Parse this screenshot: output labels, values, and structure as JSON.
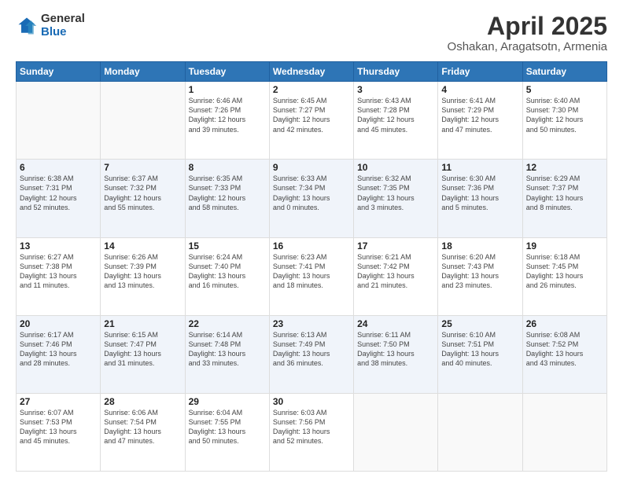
{
  "header": {
    "logo_general": "General",
    "logo_blue": "Blue",
    "title": "April 2025",
    "subtitle": "Oshakan, Aragatsotn, Armenia"
  },
  "weekdays": [
    "Sunday",
    "Monday",
    "Tuesday",
    "Wednesday",
    "Thursday",
    "Friday",
    "Saturday"
  ],
  "weeks": [
    [
      {
        "day": "",
        "info": ""
      },
      {
        "day": "",
        "info": ""
      },
      {
        "day": "1",
        "info": "Sunrise: 6:46 AM\nSunset: 7:26 PM\nDaylight: 12 hours\nand 39 minutes."
      },
      {
        "day": "2",
        "info": "Sunrise: 6:45 AM\nSunset: 7:27 PM\nDaylight: 12 hours\nand 42 minutes."
      },
      {
        "day": "3",
        "info": "Sunrise: 6:43 AM\nSunset: 7:28 PM\nDaylight: 12 hours\nand 45 minutes."
      },
      {
        "day": "4",
        "info": "Sunrise: 6:41 AM\nSunset: 7:29 PM\nDaylight: 12 hours\nand 47 minutes."
      },
      {
        "day": "5",
        "info": "Sunrise: 6:40 AM\nSunset: 7:30 PM\nDaylight: 12 hours\nand 50 minutes."
      }
    ],
    [
      {
        "day": "6",
        "info": "Sunrise: 6:38 AM\nSunset: 7:31 PM\nDaylight: 12 hours\nand 52 minutes."
      },
      {
        "day": "7",
        "info": "Sunrise: 6:37 AM\nSunset: 7:32 PM\nDaylight: 12 hours\nand 55 minutes."
      },
      {
        "day": "8",
        "info": "Sunrise: 6:35 AM\nSunset: 7:33 PM\nDaylight: 12 hours\nand 58 minutes."
      },
      {
        "day": "9",
        "info": "Sunrise: 6:33 AM\nSunset: 7:34 PM\nDaylight: 13 hours\nand 0 minutes."
      },
      {
        "day": "10",
        "info": "Sunrise: 6:32 AM\nSunset: 7:35 PM\nDaylight: 13 hours\nand 3 minutes."
      },
      {
        "day": "11",
        "info": "Sunrise: 6:30 AM\nSunset: 7:36 PM\nDaylight: 13 hours\nand 5 minutes."
      },
      {
        "day": "12",
        "info": "Sunrise: 6:29 AM\nSunset: 7:37 PM\nDaylight: 13 hours\nand 8 minutes."
      }
    ],
    [
      {
        "day": "13",
        "info": "Sunrise: 6:27 AM\nSunset: 7:38 PM\nDaylight: 13 hours\nand 11 minutes."
      },
      {
        "day": "14",
        "info": "Sunrise: 6:26 AM\nSunset: 7:39 PM\nDaylight: 13 hours\nand 13 minutes."
      },
      {
        "day": "15",
        "info": "Sunrise: 6:24 AM\nSunset: 7:40 PM\nDaylight: 13 hours\nand 16 minutes."
      },
      {
        "day": "16",
        "info": "Sunrise: 6:23 AM\nSunset: 7:41 PM\nDaylight: 13 hours\nand 18 minutes."
      },
      {
        "day": "17",
        "info": "Sunrise: 6:21 AM\nSunset: 7:42 PM\nDaylight: 13 hours\nand 21 minutes."
      },
      {
        "day": "18",
        "info": "Sunrise: 6:20 AM\nSunset: 7:43 PM\nDaylight: 13 hours\nand 23 minutes."
      },
      {
        "day": "19",
        "info": "Sunrise: 6:18 AM\nSunset: 7:45 PM\nDaylight: 13 hours\nand 26 minutes."
      }
    ],
    [
      {
        "day": "20",
        "info": "Sunrise: 6:17 AM\nSunset: 7:46 PM\nDaylight: 13 hours\nand 28 minutes."
      },
      {
        "day": "21",
        "info": "Sunrise: 6:15 AM\nSunset: 7:47 PM\nDaylight: 13 hours\nand 31 minutes."
      },
      {
        "day": "22",
        "info": "Sunrise: 6:14 AM\nSunset: 7:48 PM\nDaylight: 13 hours\nand 33 minutes."
      },
      {
        "day": "23",
        "info": "Sunrise: 6:13 AM\nSunset: 7:49 PM\nDaylight: 13 hours\nand 36 minutes."
      },
      {
        "day": "24",
        "info": "Sunrise: 6:11 AM\nSunset: 7:50 PM\nDaylight: 13 hours\nand 38 minutes."
      },
      {
        "day": "25",
        "info": "Sunrise: 6:10 AM\nSunset: 7:51 PM\nDaylight: 13 hours\nand 40 minutes."
      },
      {
        "day": "26",
        "info": "Sunrise: 6:08 AM\nSunset: 7:52 PM\nDaylight: 13 hours\nand 43 minutes."
      }
    ],
    [
      {
        "day": "27",
        "info": "Sunrise: 6:07 AM\nSunset: 7:53 PM\nDaylight: 13 hours\nand 45 minutes."
      },
      {
        "day": "28",
        "info": "Sunrise: 6:06 AM\nSunset: 7:54 PM\nDaylight: 13 hours\nand 47 minutes."
      },
      {
        "day": "29",
        "info": "Sunrise: 6:04 AM\nSunset: 7:55 PM\nDaylight: 13 hours\nand 50 minutes."
      },
      {
        "day": "30",
        "info": "Sunrise: 6:03 AM\nSunset: 7:56 PM\nDaylight: 13 hours\nand 52 minutes."
      },
      {
        "day": "",
        "info": ""
      },
      {
        "day": "",
        "info": ""
      },
      {
        "day": "",
        "info": ""
      }
    ]
  ]
}
